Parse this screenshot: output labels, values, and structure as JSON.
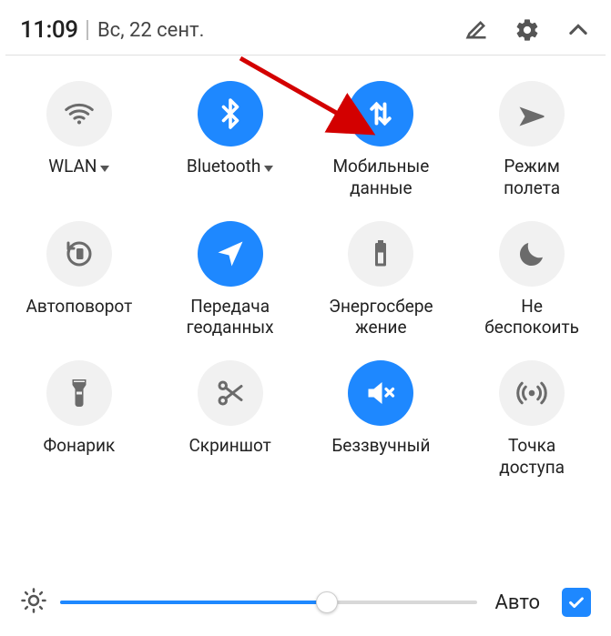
{
  "header": {
    "time": "11:09",
    "date": "Вс, 22 сент."
  },
  "tiles": [
    {
      "label": "WLAN",
      "expandable": true
    },
    {
      "label": "Bluetooth",
      "expandable": true
    },
    {
      "label": "Мобильные\nданные"
    },
    {
      "label": "Режим\nполета"
    },
    {
      "label": "Автоповорот"
    },
    {
      "label": "Передача\nгеоданных"
    },
    {
      "label": "Энергосбере\nжение"
    },
    {
      "label": "Не\nбеспокоить"
    },
    {
      "label": "Фонарик"
    },
    {
      "label": "Скриншот"
    },
    {
      "label": "Беззвучный"
    },
    {
      "label": "Точка\nдоступа"
    }
  ],
  "brightness": {
    "auto_label": "Авто",
    "auto_checked": true,
    "value_percent": 64
  },
  "colors": {
    "accent": "#1e88ff"
  }
}
